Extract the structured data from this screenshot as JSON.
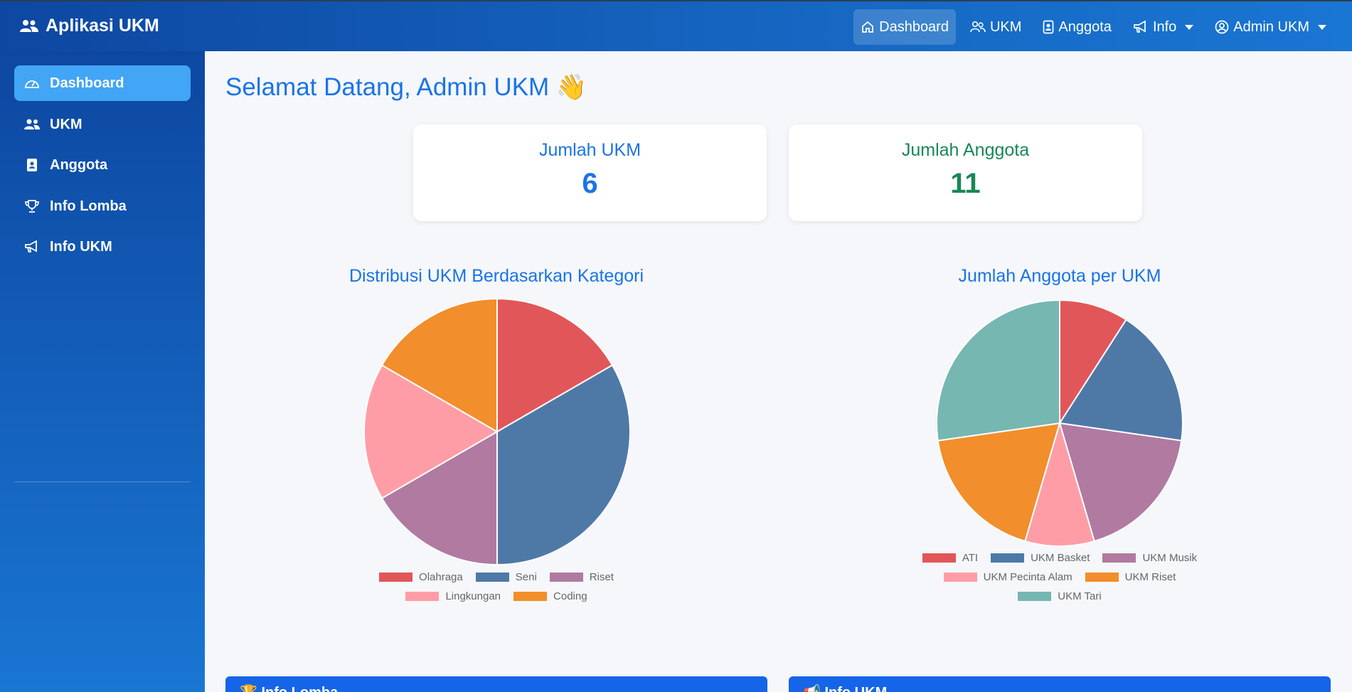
{
  "app": {
    "title": "Aplikasi UKM",
    "icon": "users-icon"
  },
  "topnav": {
    "items": [
      {
        "label": "Dashboard",
        "icon": "home-icon",
        "active": true
      },
      {
        "label": "UKM",
        "icon": "people-icon"
      },
      {
        "label": "Anggota",
        "icon": "id-badge-icon"
      },
      {
        "label": "Info",
        "icon": "megaphone-icon",
        "dropdown": true
      },
      {
        "label": "Admin UKM",
        "icon": "user-circle-icon",
        "dropdown": true
      }
    ]
  },
  "sidebar": {
    "items": [
      {
        "label": "Dashboard",
        "icon": "gauge-icon",
        "active": true
      },
      {
        "label": "UKM",
        "icon": "users-icon"
      },
      {
        "label": "Anggota",
        "icon": "id-badge-icon"
      },
      {
        "label": "Info Lomba",
        "icon": "trophy-icon"
      },
      {
        "label": "Info UKM",
        "icon": "megaphone-icon"
      }
    ]
  },
  "welcome": {
    "text": "Selamat Datang, Admin UKM 👋"
  },
  "stats": [
    {
      "title": "Jumlah UKM",
      "value": "6",
      "color": "#1a73e8"
    },
    {
      "title": "Jumlah Anggota",
      "value": "11",
      "color": "#198754"
    }
  ],
  "chart_data": [
    {
      "type": "pie",
      "title": "Distribusi UKM Berdasarkan Kategori",
      "categories": [
        "Olahraga",
        "Seni",
        "Riset",
        "Lingkungan",
        "Coding"
      ],
      "values": [
        1,
        2,
        1,
        1,
        1
      ],
      "colors": [
        "#e15759",
        "#4e79a7",
        "#b07aa1",
        "#ff9da7",
        "#f28e2b"
      ],
      "legend": "bottom"
    },
    {
      "type": "pie",
      "title": "Jumlah Anggota per UKM",
      "categories": [
        "ATI",
        "UKM Basket",
        "UKM Musik",
        "UKM Pecinta Alam",
        "UKM Riset",
        "UKM Tari"
      ],
      "values": [
        1,
        2,
        2,
        1,
        2,
        3
      ],
      "colors": [
        "#e15759",
        "#4e79a7",
        "#b07aa1",
        "#ff9da7",
        "#f28e2b",
        "#76b7b2"
      ],
      "legend": "bottom"
    }
  ],
  "info_sections": [
    {
      "label": "Info Lomba",
      "icon": "trophy-icon"
    },
    {
      "label": "Info UKM",
      "icon": "megaphone-icon"
    }
  ]
}
